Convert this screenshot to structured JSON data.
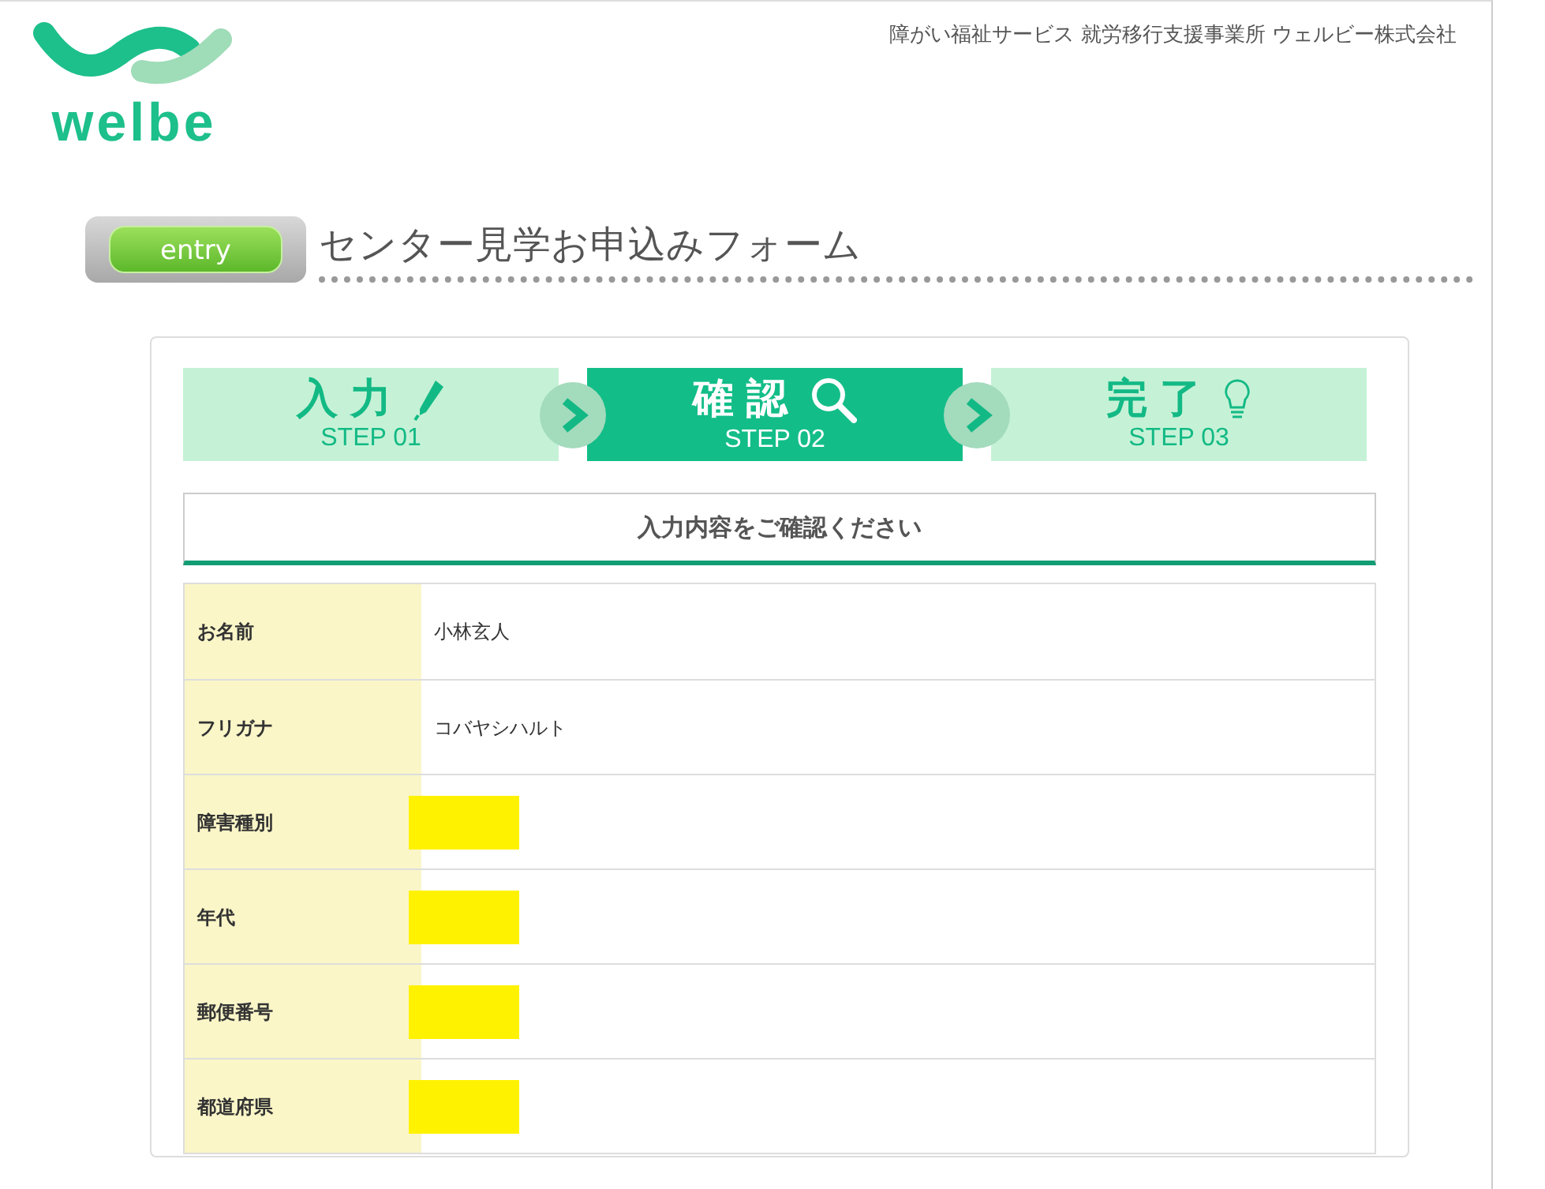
{
  "header": {
    "tagline": "障がい福祉サービス 就労移行支援事業所 ウェルビー株式会社",
    "logo_text": "welbe"
  },
  "title": {
    "badge": "entry",
    "text": "センター見学お申込みフォーム"
  },
  "steps": [
    {
      "label": "入力",
      "sub": "STEP 01",
      "selected": false,
      "kind": "pen"
    },
    {
      "label": "確認",
      "sub": "STEP 02",
      "selected": true,
      "kind": "search"
    },
    {
      "label": "完了",
      "sub": "STEP 03",
      "selected": false,
      "kind": "bulb"
    }
  ],
  "confirm_heading": "入力内容をご確認ください",
  "rows": [
    {
      "label": "お名前",
      "value": "小林玄人",
      "redacted": false
    },
    {
      "label": "フリガナ",
      "value": "コバヤシハルト",
      "redacted": false
    },
    {
      "label": "障害種別",
      "redacted": true
    },
    {
      "label": "年代",
      "redacted": true
    },
    {
      "label": "郵便番号",
      "redacted": true
    },
    {
      "label": "都道府県",
      "redacted": true
    }
  ]
}
